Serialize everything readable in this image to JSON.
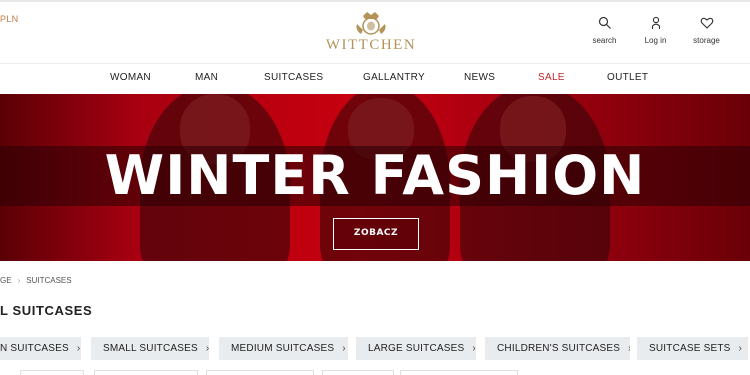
{
  "header": {
    "currency": "PLN",
    "logo_text": "WITTCHEN",
    "utilities": [
      {
        "label": "search",
        "icon": "search-icon"
      },
      {
        "label": "Log in",
        "icon": "user-icon"
      },
      {
        "label": "storage",
        "icon": "heart-icon"
      }
    ]
  },
  "nav": {
    "items": [
      {
        "label": "WOMAN"
      },
      {
        "label": "MAN"
      },
      {
        "label": "SUITCASES"
      },
      {
        "label": "GALLANTRY"
      },
      {
        "label": "NEWS"
      },
      {
        "label": "SALE",
        "color": "#c0282d"
      },
      {
        "label": "OUTLET"
      }
    ]
  },
  "hero": {
    "title": "WINTER FASHION",
    "button_label": "ZOBACZ",
    "background_color": "#b4000e"
  },
  "breadcrumb": {
    "items": [
      "GE",
      "SUITCASES"
    ]
  },
  "page": {
    "title": "L SUITCASES"
  },
  "categories": [
    {
      "label": "N SUITCASES"
    },
    {
      "label": "SMALL SUITCASES"
    },
    {
      "label": "MEDIUM SUITCASES"
    },
    {
      "label": "LARGE SUITCASES"
    },
    {
      "label": "CHILDREN'S SUITCASES"
    },
    {
      "label": "SUITCASE SETS"
    }
  ],
  "colors": {
    "accent_gold": "#b3935a",
    "sale_red": "#c0282d",
    "chip_bg": "#e9ecef"
  }
}
